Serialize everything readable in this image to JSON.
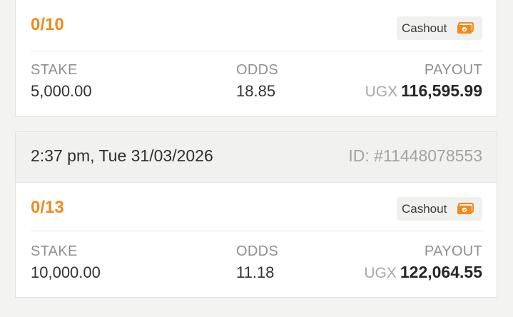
{
  "tickets": [
    {
      "score": "0/10",
      "cashout_label": "Cashout",
      "stake_label": "STAKE",
      "stake_value": "5,000.00",
      "odds_label": "ODDS",
      "odds_value": "18.85",
      "payout_label": "PAYOUT",
      "payout_currency": "UGX",
      "payout_value": "116,595.99"
    },
    {
      "time": "2:37 pm, Tue 31/03/2026",
      "id": "ID: #11448078553",
      "score": "0/13",
      "cashout_label": "Cashout",
      "stake_label": "STAKE",
      "stake_value": "10,000.00",
      "odds_label": "ODDS",
      "odds_value": "11.18",
      "payout_label": "PAYOUT",
      "payout_currency": "UGX",
      "payout_value": "122,064.55"
    }
  ],
  "colors": {
    "accent_orange": "#f08a1c",
    "header_bg": "#f1f2ef",
    "muted_text": "#8f8f8f"
  },
  "icons": {
    "cashout": "money-icon"
  }
}
